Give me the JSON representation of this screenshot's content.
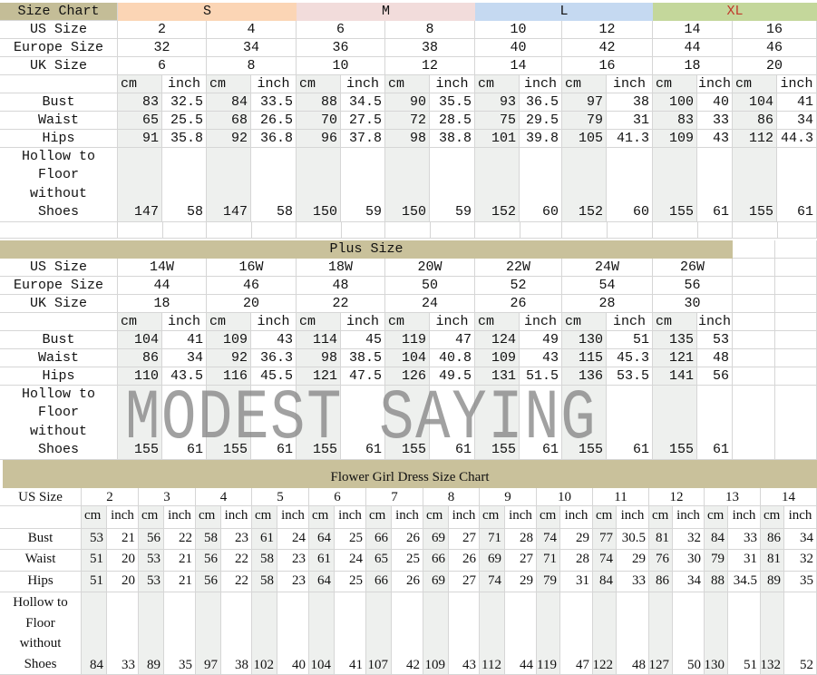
{
  "women": {
    "title": "Size Chart",
    "groups": [
      {
        "label": "S",
        "color": "#fbd5b5",
        "text_color": "#111111"
      },
      {
        "label": "M",
        "color": "#f2dcdb",
        "text_color": "#111111"
      },
      {
        "label": "L",
        "color": "#c5d9f1",
        "text_color": "#111111"
      },
      {
        "label": "XL",
        "color": "#c4d79b",
        "text_color": "#c0392b"
      }
    ],
    "size_rows": [
      {
        "label": "US Size",
        "values": [
          "2",
          "4",
          "6",
          "8",
          "10",
          "12",
          "14",
          "16"
        ]
      },
      {
        "label": "Europe Size",
        "values": [
          "32",
          "34",
          "36",
          "38",
          "40",
          "42",
          "44",
          "46"
        ]
      },
      {
        "label": "UK Size",
        "values": [
          "6",
          "8",
          "10",
          "12",
          "14",
          "16",
          "18",
          "20"
        ]
      }
    ],
    "units": {
      "cm": "cm",
      "inch": "inch"
    },
    "measure_rows": [
      {
        "label": "Bust",
        "values": [
          [
            "83",
            "32.5"
          ],
          [
            "84",
            "33.5"
          ],
          [
            "88",
            "34.5"
          ],
          [
            "90",
            "35.5"
          ],
          [
            "93",
            "36.5"
          ],
          [
            "97",
            "38"
          ],
          [
            "100",
            "40"
          ],
          [
            "104",
            "41"
          ]
        ]
      },
      {
        "label": "Waist",
        "values": [
          [
            "65",
            "25.5"
          ],
          [
            "68",
            "26.5"
          ],
          [
            "70",
            "27.5"
          ],
          [
            "72",
            "28.5"
          ],
          [
            "75",
            "29.5"
          ],
          [
            "79",
            "31"
          ],
          [
            "83",
            "33"
          ],
          [
            "86",
            "34"
          ]
        ]
      },
      {
        "label": "Hips",
        "values": [
          [
            "91",
            "35.8"
          ],
          [
            "92",
            "36.8"
          ],
          [
            "96",
            "37.8"
          ],
          [
            "98",
            "38.8"
          ],
          [
            "101",
            "39.8"
          ],
          [
            "105",
            "41.3"
          ],
          [
            "109",
            "43"
          ],
          [
            "112",
            "44.3"
          ]
        ]
      }
    ],
    "length_row": {
      "label_lines": [
        "Hollow to",
        "Floor",
        "without",
        "Shoes"
      ],
      "values": [
        [
          "147",
          "58"
        ],
        [
          "147",
          "58"
        ],
        [
          "150",
          "59"
        ],
        [
          "150",
          "59"
        ],
        [
          "152",
          "60"
        ],
        [
          "152",
          "60"
        ],
        [
          "155",
          "61"
        ],
        [
          "155",
          "61"
        ]
      ]
    }
  },
  "plus": {
    "title": "Plus Size",
    "size_rows": [
      {
        "label": "US Size",
        "values": [
          "14W",
          "16W",
          "18W",
          "20W",
          "22W",
          "24W",
          "26W"
        ]
      },
      {
        "label": "Europe Size",
        "values": [
          "44",
          "46",
          "48",
          "50",
          "52",
          "54",
          "56"
        ]
      },
      {
        "label": "UK Size",
        "values": [
          "18",
          "20",
          "22",
          "24",
          "26",
          "28",
          "30"
        ]
      }
    ],
    "units": {
      "cm": "cm",
      "inch": "inch"
    },
    "measure_rows": [
      {
        "label": "Bust",
        "values": [
          [
            "104",
            "41"
          ],
          [
            "109",
            "43"
          ],
          [
            "114",
            "45"
          ],
          [
            "119",
            "47"
          ],
          [
            "124",
            "49"
          ],
          [
            "130",
            "51"
          ],
          [
            "135",
            "53"
          ]
        ]
      },
      {
        "label": "Waist",
        "values": [
          [
            "86",
            "34"
          ],
          [
            "92",
            "36.3"
          ],
          [
            "98",
            "38.5"
          ],
          [
            "104",
            "40.8"
          ],
          [
            "109",
            "43"
          ],
          [
            "115",
            "45.3"
          ],
          [
            "121",
            "48"
          ]
        ]
      },
      {
        "label": "Hips",
        "values": [
          [
            "110",
            "43.5"
          ],
          [
            "116",
            "45.5"
          ],
          [
            "121",
            "47.5"
          ],
          [
            "126",
            "49.5"
          ],
          [
            "131",
            "51.5"
          ],
          [
            "136",
            "53.5"
          ],
          [
            "141",
            "56"
          ]
        ]
      }
    ],
    "length_row": {
      "label_lines": [
        "Hollow to",
        "Floor",
        "without",
        "Shoes"
      ],
      "values": [
        [
          "155",
          "61"
        ],
        [
          "155",
          "61"
        ],
        [
          "155",
          "61"
        ],
        [
          "155",
          "61"
        ],
        [
          "155",
          "61"
        ],
        [
          "155",
          "61"
        ],
        [
          "155",
          "61"
        ]
      ]
    }
  },
  "watermark": "MODEST SAYING",
  "flower": {
    "title": "Flower Girl Dress Size Chart",
    "size_rows": [
      {
        "label": "US Size",
        "values": [
          "2",
          "3",
          "4",
          "5",
          "6",
          "7",
          "8",
          "9",
          "10",
          "11",
          "12",
          "13",
          "14"
        ]
      }
    ],
    "units": {
      "cm": "cm",
      "inch": "inch"
    },
    "measure_rows": [
      {
        "label": "Bust",
        "values": [
          [
            "53",
            "21"
          ],
          [
            "56",
            "22"
          ],
          [
            "58",
            "23"
          ],
          [
            "61",
            "24"
          ],
          [
            "64",
            "25"
          ],
          [
            "66",
            "26"
          ],
          [
            "69",
            "27"
          ],
          [
            "71",
            "28"
          ],
          [
            "74",
            "29"
          ],
          [
            "77",
            "30.5"
          ],
          [
            "81",
            "32"
          ],
          [
            "84",
            "33"
          ],
          [
            "86",
            "34"
          ]
        ]
      },
      {
        "label": "Waist",
        "values": [
          [
            "51",
            "20"
          ],
          [
            "53",
            "21"
          ],
          [
            "56",
            "22"
          ],
          [
            "58",
            "23"
          ],
          [
            "61",
            "24"
          ],
          [
            "65",
            "25"
          ],
          [
            "66",
            "26"
          ],
          [
            "69",
            "27"
          ],
          [
            "71",
            "28"
          ],
          [
            "74",
            "29"
          ],
          [
            "76",
            "30"
          ],
          [
            "79",
            "31"
          ],
          [
            "81",
            "32"
          ]
        ]
      },
      {
        "label": "Hips",
        "values": [
          [
            "51",
            "20"
          ],
          [
            "53",
            "21"
          ],
          [
            "56",
            "22"
          ],
          [
            "58",
            "23"
          ],
          [
            "64",
            "25"
          ],
          [
            "66",
            "26"
          ],
          [
            "69",
            "27"
          ],
          [
            "74",
            "29"
          ],
          [
            "79",
            "31"
          ],
          [
            "84",
            "33"
          ],
          [
            "86",
            "34"
          ],
          [
            "88",
            "34.5"
          ],
          [
            "89",
            "35"
          ]
        ]
      }
    ],
    "length_row": {
      "label_lines": [
        "Hollow to",
        "Floor",
        "without",
        "Shoes"
      ],
      "values": [
        [
          "84",
          "33"
        ],
        [
          "89",
          "35"
        ],
        [
          "97",
          "38"
        ],
        [
          "102",
          "40"
        ],
        [
          "104",
          "41"
        ],
        [
          "107",
          "42"
        ],
        [
          "109",
          "43"
        ],
        [
          "112",
          "44"
        ],
        [
          "119",
          "47"
        ],
        [
          "122",
          "48"
        ],
        [
          "127",
          "50"
        ],
        [
          "130",
          "51"
        ],
        [
          "132",
          "52"
        ]
      ]
    }
  }
}
